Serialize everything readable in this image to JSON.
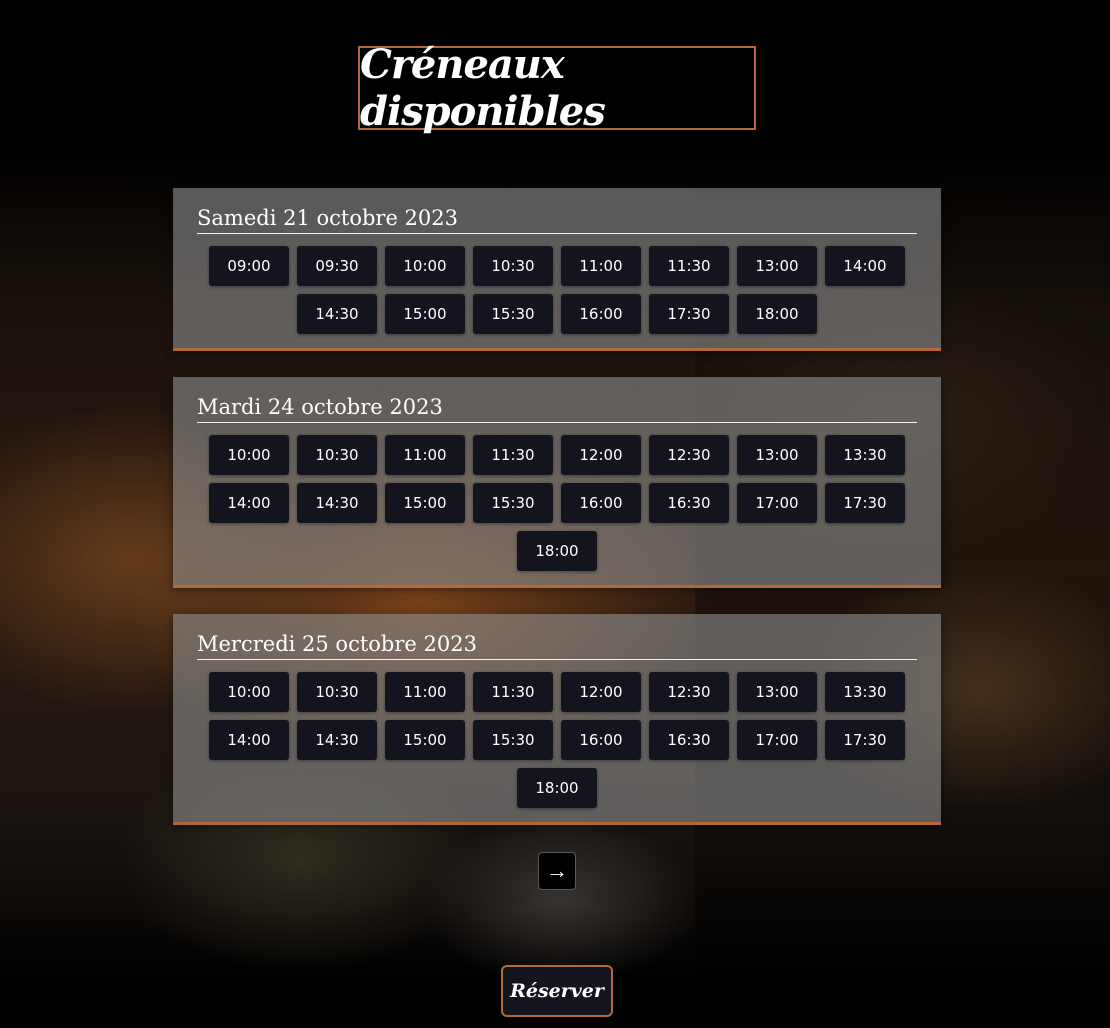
{
  "header": {
    "title": "Créneaux disponibles"
  },
  "days": [
    {
      "date_label": "Samedi 21 octobre 2023",
      "slots": [
        "09:00",
        "09:30",
        "10:00",
        "10:30",
        "11:00",
        "11:30",
        "13:00",
        "14:00",
        "14:30",
        "15:00",
        "15:30",
        "16:00",
        "17:30",
        "18:00"
      ]
    },
    {
      "date_label": "Mardi 24 octobre 2023",
      "slots": [
        "10:00",
        "10:30",
        "11:00",
        "11:30",
        "12:00",
        "12:30",
        "13:00",
        "13:30",
        "14:00",
        "14:30",
        "15:00",
        "15:30",
        "16:00",
        "16:30",
        "17:00",
        "17:30",
        "18:00"
      ]
    },
    {
      "date_label": "Mercredi 25 octobre 2023",
      "slots": [
        "10:00",
        "10:30",
        "11:00",
        "11:30",
        "12:00",
        "12:30",
        "13:00",
        "13:30",
        "14:00",
        "14:30",
        "15:00",
        "15:30",
        "16:00",
        "16:30",
        "17:00",
        "17:30",
        "18:00"
      ]
    }
  ],
  "navigation": {
    "next_label": "→",
    "next_icon": "arrow-right-icon"
  },
  "actions": {
    "reserve_label": "Réserver"
  },
  "colors": {
    "accent": "#b5693a",
    "slot_bg": "#14141f",
    "card_bg": "#8c8c8c"
  }
}
